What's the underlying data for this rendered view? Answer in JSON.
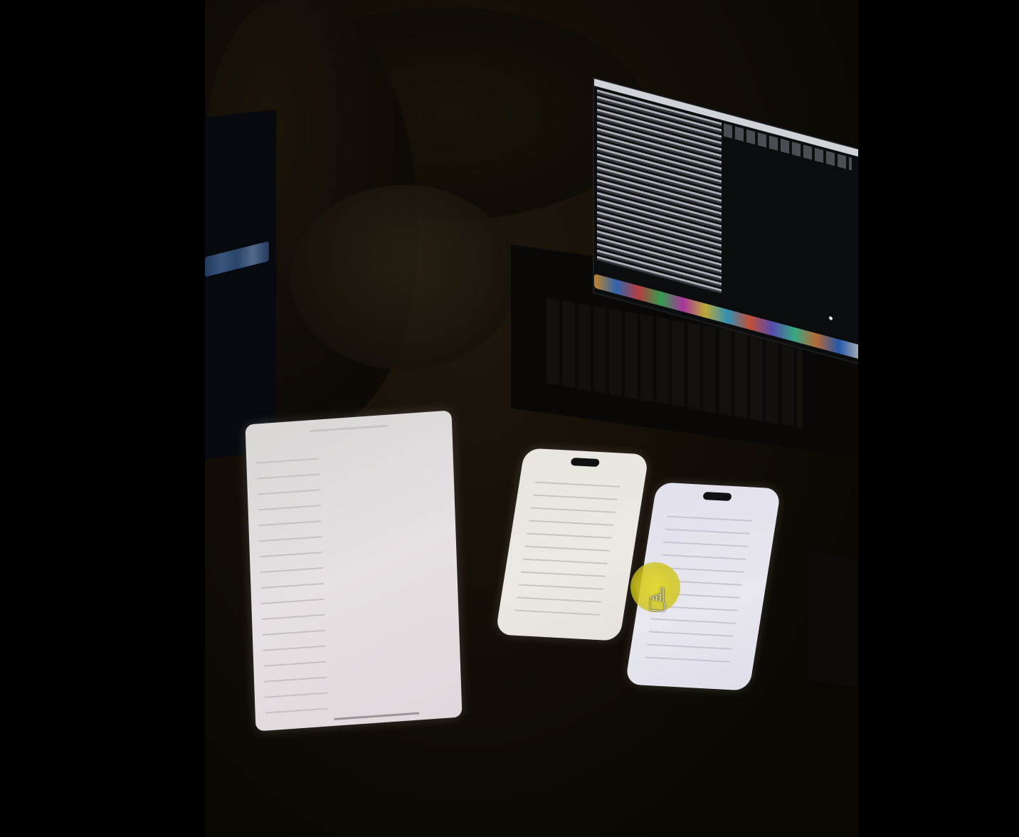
{
  "scene": {
    "colors": {
      "background": "#000000",
      "surface": "#120d06",
      "tablet_screen": "#e6e1e3",
      "phone_screen_left": "#ece8e2",
      "phone_screen_right": "#e8e6ee",
      "cursor_highlight": "#e0d828"
    },
    "cursor": {
      "icon": "pointing-hand-cursor-icon"
    }
  }
}
